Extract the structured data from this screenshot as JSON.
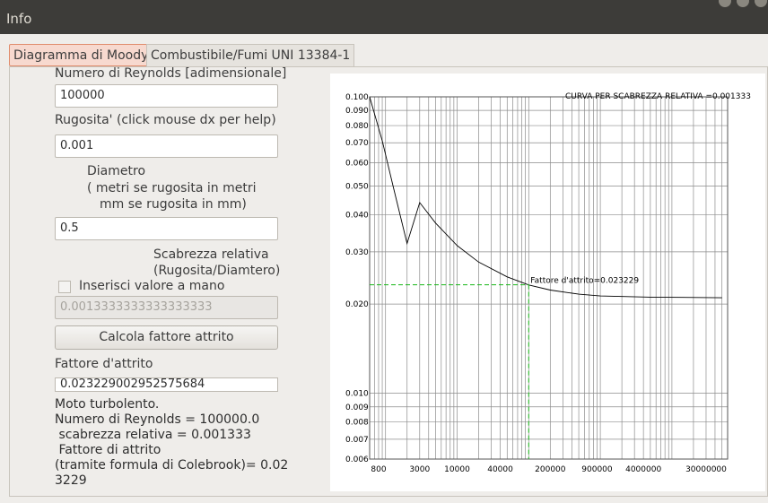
{
  "window": {
    "title": "Info"
  },
  "tabs": [
    {
      "label": "Diagramma di Moody",
      "active": true
    },
    {
      "label": "Combustibile/Fumi UNI 13384-1",
      "active": false
    }
  ],
  "form": {
    "reynolds_label": "Numero di Reynolds [adimensionale]",
    "reynolds_value": "100000",
    "roughness_label": "Rugosita' (click mouse dx per help)",
    "roughness_value": "0.001",
    "diameter_label_1": "Diametro",
    "diameter_label_2": "( metri se rugosita in metri",
    "diameter_label_3": "mm se rugosita in mm)",
    "diameter_value": "0.5",
    "relative_label_1": "Scabrezza relativa",
    "relative_label_2": "(Rugosita/Diamtero)",
    "manual_checkbox_label": "Inserisci valore a mano",
    "manual_checked": false,
    "relative_value": "0.0013333333333333333",
    "calc_button": "Calcola fattore attrito",
    "friction_label": "Fattore d'attrito",
    "friction_value": "0.023229002952575684"
  },
  "result": {
    "line1": "Moto turbolento.",
    "line2": "Numero di Reynolds = 100000.0",
    "line3": " scabrezza relativa = 0.001333",
    "line4": " Fattore di attrito",
    "line5": "(tramite formula di Colebrook)= 0.02",
    "line6": "3229"
  },
  "chart_data": {
    "type": "line",
    "title": "CURVA PER SCABREZZA RELATIVA =0.001333",
    "x_scale": "log",
    "y_scale": "log",
    "xlim": [
      600,
      60000000
    ],
    "ylim": [
      0.006,
      0.1
    ],
    "grid": true,
    "x_tick_labels": [
      "800",
      "3000",
      "10000",
      "40000",
      "200000",
      "900000",
      "4000000",
      "30000000"
    ],
    "x_ticks": [
      800,
      3000,
      10000,
      40000,
      200000,
      900000,
      4000000,
      30000000
    ],
    "y_tick_labels": [
      "0.100",
      "0.090",
      "0.080",
      "0.070",
      "0.060",
      "0.050",
      "0.040",
      "0.030",
      "0.020",
      "0.010",
      "0.009",
      "0.008",
      "0.007",
      "0.006"
    ],
    "y_ticks": [
      0.1,
      0.09,
      0.08,
      0.07,
      0.06,
      0.05,
      0.04,
      0.03,
      0.02,
      0.01,
      0.009,
      0.008,
      0.007,
      0.006
    ],
    "series": [
      {
        "x": [
          600,
          900,
          1300,
          2000,
          3000,
          5000,
          10000,
          20000,
          50000,
          100000,
          200000,
          500000,
          1000000,
          5000000,
          50000000
        ],
        "y": [
          0.107,
          0.071,
          0.049,
          0.032,
          0.044,
          0.0375,
          0.0315,
          0.0277,
          0.0247,
          0.0232,
          0.0223,
          0.0216,
          0.0213,
          0.0211,
          0.021
        ],
        "color": "#000000"
      }
    ],
    "marker": {
      "x": 100000,
      "y": 0.023229,
      "color": "#18b818"
    },
    "annotation": "Fattore d'attrito=0.023229"
  }
}
